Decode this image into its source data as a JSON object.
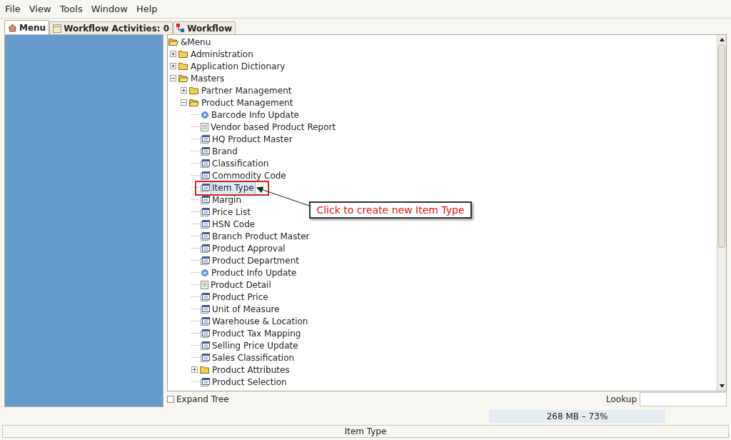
{
  "menu_bar": [
    "File",
    "View",
    "Tools",
    "Window",
    "Help"
  ],
  "tabs": [
    {
      "label": "Menu",
      "selected": true
    },
    {
      "label": "Workflow Activities: 0",
      "selected": false
    },
    {
      "label": "Workflow",
      "selected": false
    }
  ],
  "tree": {
    "label": "&Menu",
    "kind": "folder",
    "expanded": true,
    "children": [
      {
        "label": "Administration",
        "kind": "folder",
        "expanded": false
      },
      {
        "label": "Application Dictionary",
        "kind": "folder",
        "expanded": false
      },
      {
        "label": "Masters",
        "kind": "folder",
        "expanded": true,
        "children": [
          {
            "label": "Partner Management",
            "kind": "folder",
            "expanded": false
          },
          {
            "label": "Product Management",
            "kind": "folder",
            "expanded": true,
            "children": [
              {
                "label": "Barcode Info Update",
                "kind": "process",
                "selected": false
              },
              {
                "label": "Vendor based Product Report",
                "kind": "report",
                "selected": false
              },
              {
                "label": "HQ Product Master",
                "kind": "window",
                "selected": false
              },
              {
                "label": "Brand",
                "kind": "window",
                "selected": false
              },
              {
                "label": "Classification",
                "kind": "window",
                "selected": false
              },
              {
                "label": "Commodity Code",
                "kind": "window",
                "selected": false
              },
              {
                "label": "Item Type",
                "kind": "window",
                "selected": true
              },
              {
                "label": "Margin",
                "kind": "window",
                "selected": false
              },
              {
                "label": "Price List",
                "kind": "window",
                "selected": false
              },
              {
                "label": "HSN Code",
                "kind": "window",
                "selected": false
              },
              {
                "label": "Branch Product Master",
                "kind": "window",
                "selected": false
              },
              {
                "label": "Product Approval",
                "kind": "window",
                "selected": false
              },
              {
                "label": "Product Department",
                "kind": "window",
                "selected": false
              },
              {
                "label": "Product Info Update",
                "kind": "process",
                "selected": false
              },
              {
                "label": "Product Detail",
                "kind": "report",
                "selected": false
              },
              {
                "label": "Product Price",
                "kind": "window",
                "selected": false
              },
              {
                "label": "Unit of Measure",
                "kind": "window",
                "selected": false
              },
              {
                "label": "Warehouse & Location",
                "kind": "window",
                "selected": false
              },
              {
                "label": "Product Tax Mapping",
                "kind": "window",
                "selected": false
              },
              {
                "label": "Selling Price Update",
                "kind": "window",
                "selected": false
              },
              {
                "label": "Sales Classification",
                "kind": "window",
                "selected": false
              },
              {
                "label": "Product Attributes",
                "kind": "folder",
                "expanded": false
              },
              {
                "label": "Product Selection",
                "kind": "window",
                "selected": false
              }
            ]
          }
        ]
      }
    ]
  },
  "callout": {
    "text": "Click to create new Item Type"
  },
  "expand_tree": {
    "label": "Expand Tree",
    "checked": false
  },
  "lookup": {
    "label": "Lookup"
  },
  "memory": "268 MB – 73%",
  "status_bar": "Item Type"
}
